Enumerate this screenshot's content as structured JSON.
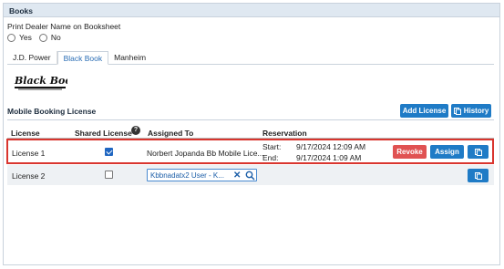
{
  "panel": {
    "title": "Books"
  },
  "print_option": {
    "label": "Print Dealer Name on Booksheet",
    "options": [
      "Yes",
      "No"
    ]
  },
  "tabs": [
    "J.D. Power",
    "Black Book",
    "Manheim"
  ],
  "active_tab": "Black Book",
  "logo": {
    "text": "Black Book"
  },
  "section": {
    "title": "Mobile Booking License",
    "add_license": "Add License",
    "history": "History"
  },
  "table": {
    "headers": {
      "license": "License",
      "shared": "Shared License",
      "assigned": "Assigned To",
      "reservation": "Reservation"
    },
    "rows": [
      {
        "license": "License 1",
        "shared": true,
        "assigned": "Norbert Jopanda Bb Mobile Lice...",
        "start_label": "Start:",
        "start": "9/17/2024 12:09 AM",
        "end_label": "End:",
        "end": "9/17/2024 1:09 AM",
        "revoke": "Revoke",
        "assign": "Assign"
      },
      {
        "license": "License 2",
        "shared": false,
        "assigned_input": "Kbbnadatx2 User - K..."
      }
    ]
  },
  "colors": {
    "accent": "#1f7bc6",
    "danger": "#e05252",
    "highlight": "#d9352e"
  }
}
